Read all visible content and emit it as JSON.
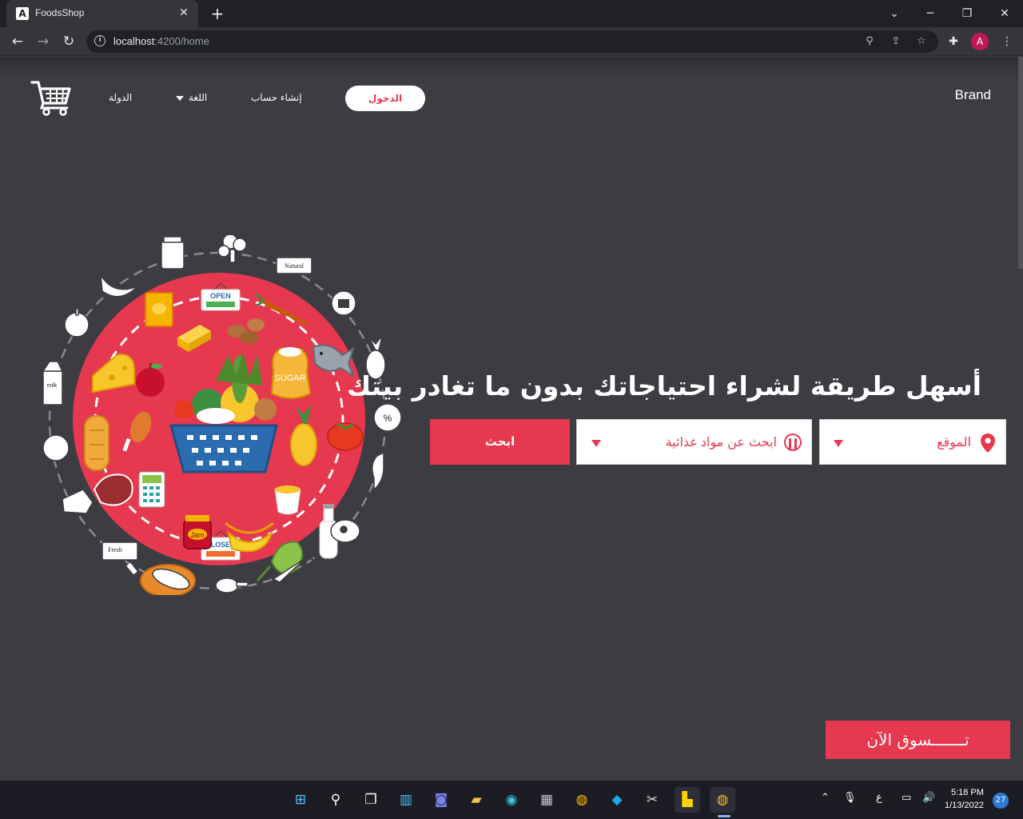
{
  "browser": {
    "tab_title": "FoodsShop",
    "tab_favicon": "A",
    "url_host": "localhost",
    "url_path": ":4200/home",
    "profile_initial": "A"
  },
  "nav": {
    "brand": "Brand",
    "login": "الدخول",
    "signup": "إنشاء حساب",
    "language": "اللغة",
    "country": "الدولة"
  },
  "hero": {
    "headline": "أسهل طريقة لشراء احتياجاتك بدون ما تغادر بيتك",
    "location_label": "الموقع",
    "food_label": "ابحث عن مواد غذائية",
    "search_button": "ابحث",
    "shop_now": "تـــــــسوق الآن"
  },
  "illustration": {
    "sign_open": "OPEN",
    "sign_closed": "CLOSED",
    "sugar": "SUGAR",
    "jam": "Jam",
    "label_natural": "Natural",
    "label_fresh": "Fresh",
    "label_milk": "milk",
    "label_percent": "%"
  },
  "colors": {
    "accent": "#e63950",
    "background": "#3d3c42"
  },
  "taskbar": {
    "time": "5:18 PM",
    "date": "1/13/2022",
    "input_lang": "ع",
    "notifications": "27"
  }
}
